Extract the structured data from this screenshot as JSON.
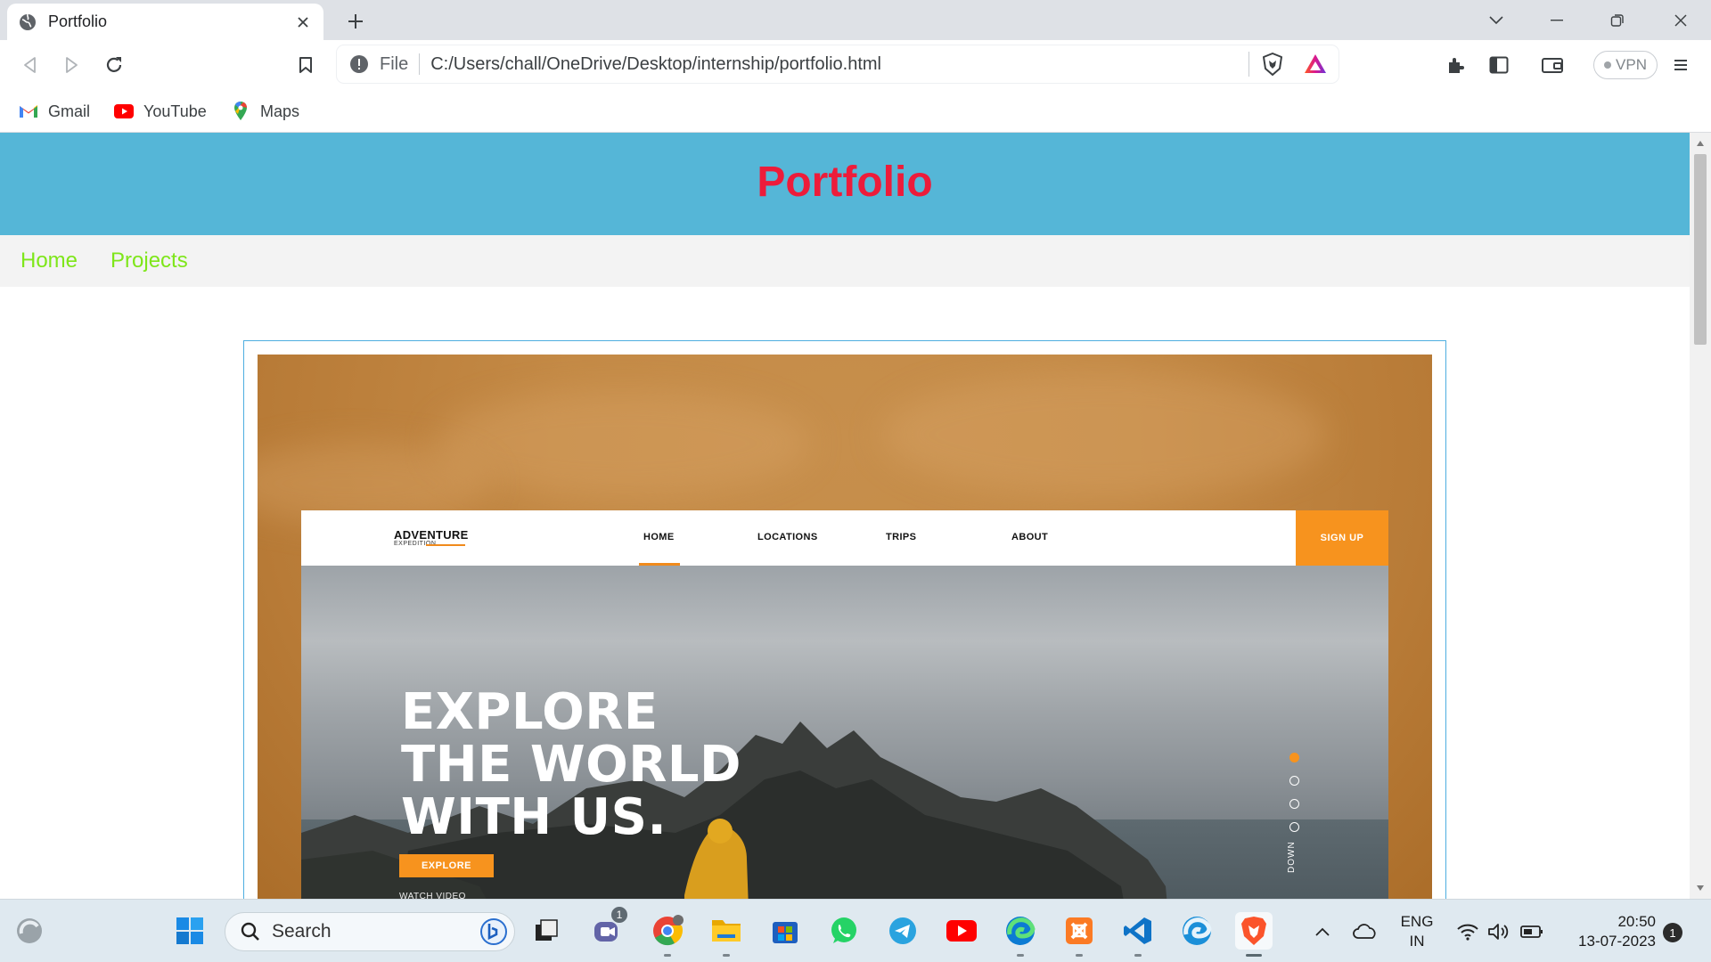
{
  "browser": {
    "tab_title": "Portfolio",
    "omnibox": {
      "scheme": "File",
      "url": "C:/Users/chall/OneDrive/Desktop/internship/portfolio.html"
    },
    "vpn_label": "VPN",
    "bookmarks": [
      {
        "label": "Gmail",
        "icon": "gmail-icon"
      },
      {
        "label": "YouTube",
        "icon": "youtube-icon"
      },
      {
        "label": "Maps",
        "icon": "maps-icon"
      }
    ]
  },
  "page": {
    "title": "Portfolio",
    "title_color": "#ed1c3a",
    "header_bg": "#55b6d7",
    "nav_color": "#7ee61a",
    "nav": [
      {
        "label": "Home"
      },
      {
        "label": "Projects"
      }
    ],
    "project_preview": {
      "logo": "ADVENTURE",
      "logo_sub": "EXPEDITION",
      "nav": [
        "HOME",
        "LOCATIONS",
        "TRIPS",
        "ABOUT"
      ],
      "signup": "SIGN UP",
      "hero_lines": [
        "EXPLORE",
        "THE WORLD",
        "WITH US."
      ],
      "cta": "EXPLORE",
      "watch": "WATCH VIDEO",
      "scroll_hint": "DOWN",
      "accent": "#f7931e"
    }
  },
  "taskbar": {
    "search_label": "Search",
    "teams_badge": "1",
    "lang_line1": "ENG",
    "lang_line2": "IN",
    "time": "20:50",
    "date": "13-07-2023",
    "notifications": "1",
    "apps": [
      "start-icon",
      "teams-icon",
      "chrome-icon",
      "file-explorer-icon",
      "microsoft-store-icon",
      "whatsapp-icon",
      "telegram-icon",
      "youtube-app-icon",
      "edge-icon",
      "xampp-icon",
      "vscode-icon",
      "edge-dev-icon",
      "brave-icon"
    ]
  }
}
